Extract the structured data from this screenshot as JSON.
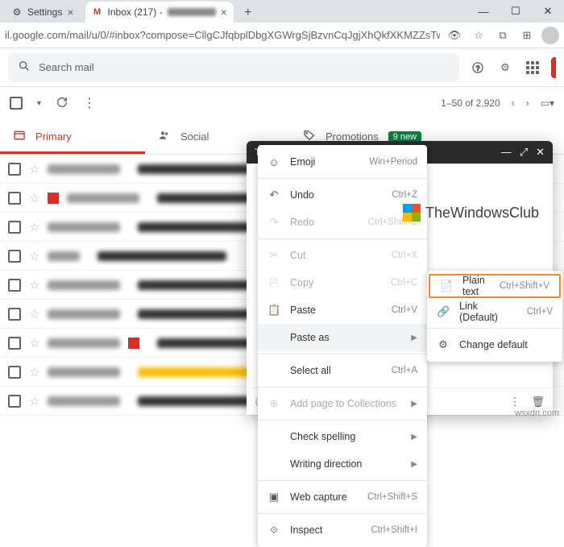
{
  "browser": {
    "tabs": [
      {
        "title": "Settings",
        "favicon": "gear"
      },
      {
        "title": "Inbox (217) - ",
        "favicon": "gmail"
      }
    ],
    "url": "il.google.com/mail/u/0/#inbox?compose=CllgCJfqbplDbgXGWrgSjBzvnCqJgjXhQkfXKMZZsTwnM..."
  },
  "gmail": {
    "search_placeholder": "Search mail",
    "pagination": "1–50 of 2,920",
    "tabs": {
      "primary": "Primary",
      "social": "Social",
      "promotions": "Promotions",
      "promo_badge": "9 new"
    }
  },
  "compose": {
    "title_initial": "T"
  },
  "context_menu": {
    "emoji": {
      "label": "Emoji",
      "shortcut": "Win+Period"
    },
    "undo": {
      "label": "Undo",
      "shortcut": "Ctrl+Z"
    },
    "redo": {
      "label": "Redo",
      "shortcut": "Ctrl+Shift+Z"
    },
    "cut": {
      "label": "Cut",
      "shortcut": "Ctrl+X"
    },
    "copy": {
      "label": "Copy",
      "shortcut": "Ctrl+C"
    },
    "paste": {
      "label": "Paste",
      "shortcut": "Ctrl+V"
    },
    "paste_as": {
      "label": "Paste as"
    },
    "select_all": {
      "label": "Select all",
      "shortcut": "Ctrl+A"
    },
    "add_collections": {
      "label": "Add page to Collections"
    },
    "check_spelling": {
      "label": "Check spelling"
    },
    "writing_direction": {
      "label": "Writing direction"
    },
    "web_capture": {
      "label": "Web capture",
      "shortcut": "Ctrl+Shift+S"
    },
    "inspect": {
      "label": "Inspect",
      "shortcut": "Ctrl+Shift+I"
    }
  },
  "submenu": {
    "plain_text": {
      "label": "Plain text",
      "shortcut": "Ctrl+Shift+V"
    },
    "link_default": {
      "label": "Link (Default)",
      "shortcut": "Ctrl+V"
    },
    "change_default": {
      "label": "Change default"
    }
  },
  "watermark": {
    "twc": "TheWindowsClub",
    "wsxdn": "wsxdn.com"
  }
}
